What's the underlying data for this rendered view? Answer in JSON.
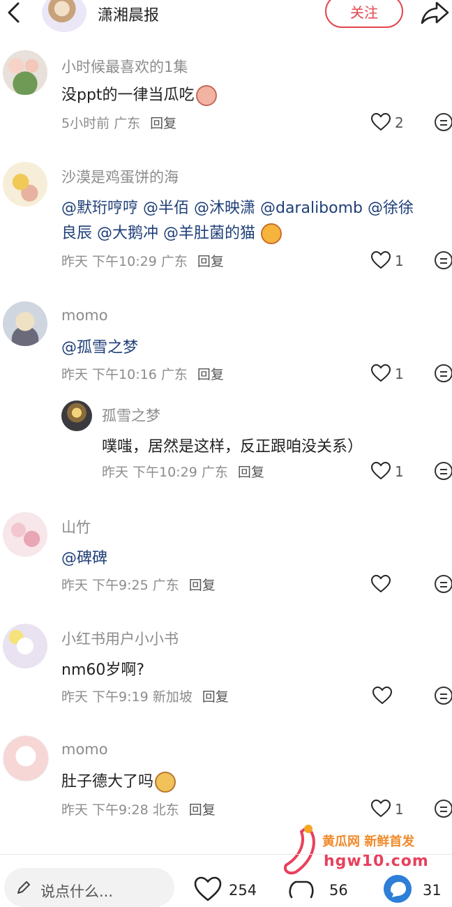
{
  "header": {
    "title": "潇湘晨报",
    "follow_label": "关注"
  },
  "comments": [
    {
      "name": "小时候最喜欢的1集",
      "text": "没ppt的一律当瓜吃",
      "time": "5小时前",
      "location": "广东",
      "reply_label": "回复",
      "likes": "2"
    },
    {
      "name": "沙漠是鸡蛋饼的海",
      "line1": "@默珩哼哼 @半佰 @沐映潇 @daralibomb @徐徐",
      "line2": "良辰 @大鹅冲 @羊肚菌的猫",
      "time": "昨天 下午10:29",
      "location": "广东",
      "reply_label": "回复",
      "likes": "1"
    },
    {
      "name": "momo",
      "text": "@孤雪之梦",
      "time": "昨天 下午10:16",
      "location": "广东",
      "reply_label": "回复",
      "likes": "1"
    },
    {
      "name": "孤雪之梦",
      "text": "噗嗤，居然是这样，反正跟咱没关系）",
      "time": "昨天 下午10:29",
      "location": "广东",
      "reply_label": "回复",
      "likes": "1"
    },
    {
      "name": "山竹",
      "text": "@碑碑",
      "time": "昨天 下午9:25",
      "location": "广东",
      "reply_label": "回复",
      "likes": ""
    },
    {
      "name": "小红书用户小小书",
      "text": "nm60岁啊?",
      "time": "昨天 下午9:19",
      "location": "新加坡",
      "reply_label": "回复",
      "likes": ""
    },
    {
      "name": "momo",
      "text": "肚子德大了吗",
      "time": "昨天 下午9:28",
      "location": "北东",
      "reply_label": "回复",
      "likes": "1"
    }
  ],
  "bottom_bar": {
    "input_placeholder": "说点什么...",
    "likes_count": "254",
    "collect_count": "56",
    "comment_count": "31"
  },
  "watermark": {
    "line1": "黄瓜网 新鲜首发",
    "line2": "hgw10.com"
  },
  "colors": {
    "accent": "#e2454d",
    "mention": "#1f3f78",
    "meta": "#8c8c8c"
  }
}
